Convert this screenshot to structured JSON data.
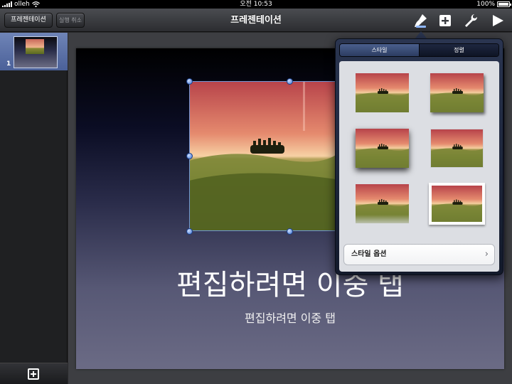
{
  "status_bar": {
    "carrier": "olleh",
    "time": "오전 10:53",
    "battery_label": "100%",
    "battery_level": 1.0
  },
  "toolbar": {
    "presentations_label": "프레젠테이션",
    "undo_label": "실행 취소",
    "title": "프레젠테이션",
    "icons": [
      "brush-icon",
      "add-icon",
      "wrench-icon",
      "play-icon"
    ]
  },
  "sidebar": {
    "slides": [
      {
        "number": "1"
      }
    ]
  },
  "slide": {
    "title": "편집하려면 이중 탭",
    "subtitle": "편집하려면 이중 탭"
  },
  "popover": {
    "tabs": [
      {
        "label": "스타일",
        "active": true
      },
      {
        "label": "정렬",
        "active": false
      }
    ],
    "style_thumbnails": [
      "plain",
      "drop-shadow",
      "deep-shadow",
      "bordered",
      "reflection",
      "white-frame"
    ],
    "options_label": "스타일 옵션",
    "chevron": "›"
  },
  "colors": {
    "toolbar": "#3a3c41",
    "sidebar_selected": "#5d72a8",
    "selection": "#6f95d6"
  }
}
